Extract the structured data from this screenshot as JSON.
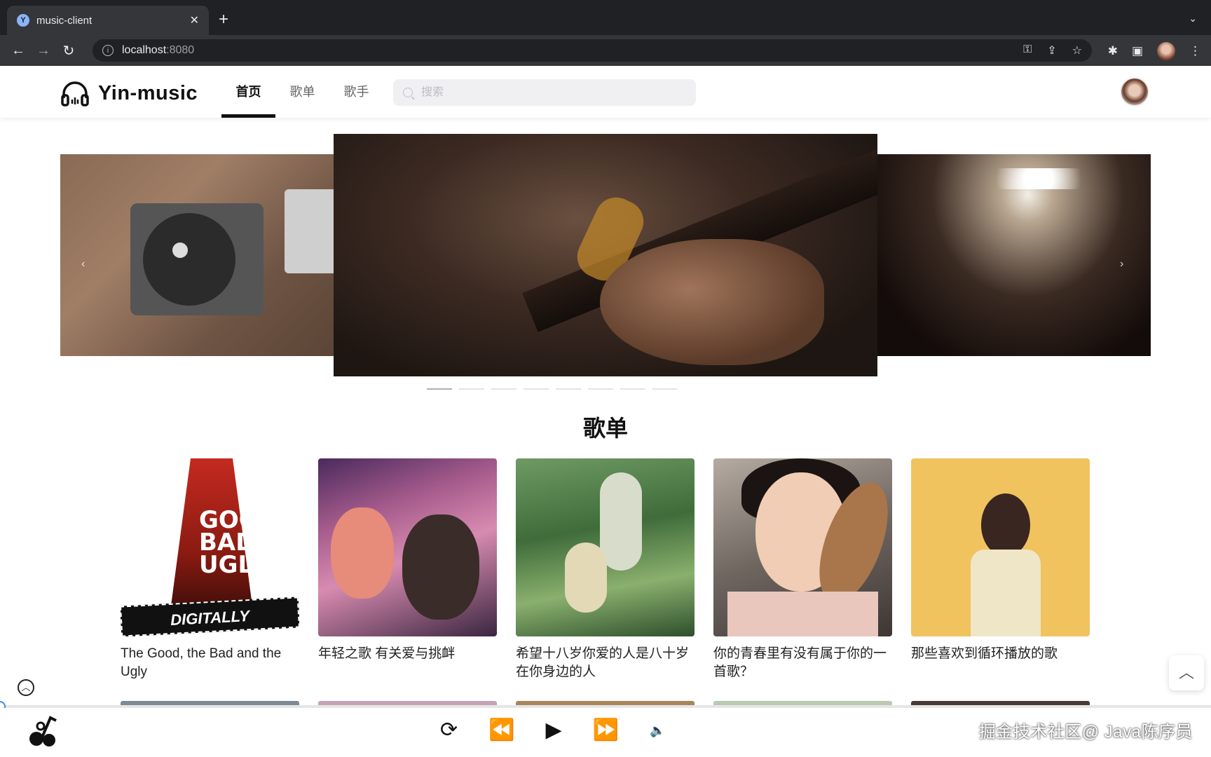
{
  "browser": {
    "tab_title": "music-client",
    "tab_favicon_letter": "Y",
    "url_host": "localhost",
    "url_port": ":8080"
  },
  "header": {
    "brand": "Yin-music",
    "nav": [
      {
        "label": "首页",
        "active": true
      },
      {
        "label": "歌单",
        "active": false
      },
      {
        "label": "歌手",
        "active": false
      }
    ],
    "search_placeholder": "搜索"
  },
  "carousel": {
    "slides": [
      "turntable-photo",
      "guitar-photo",
      "concert-photo"
    ],
    "indicator_count": 8,
    "active_indicator": 0
  },
  "section": {
    "title": "歌单"
  },
  "playlists": [
    {
      "title": "The Good, the Bad and the Ugly",
      "cover_text_1": "GOOD",
      "cover_text_2": "BAD",
      "cover_text_3": "UGLY",
      "cover_banner": "DIGITALLY REMASTERED"
    },
    {
      "title": "年轻之歌 有关爱与挑衅"
    },
    {
      "title": "希望十八岁你爱的人是八十岁在你身边的人"
    },
    {
      "title": "你的青春里有没有属于你的一首歌？"
    },
    {
      "title": "那些喜欢到循环播放的歌"
    }
  ],
  "player": {
    "icons": [
      "loop-icon",
      "previous-icon",
      "play-icon",
      "next-icon",
      "volume-icon"
    ]
  },
  "watermark": "掘金技术社区@ Java陈序员",
  "colors": {
    "browser_dark": "#202124",
    "accent": "#111111",
    "progress_handle": "#3a8ee6"
  }
}
